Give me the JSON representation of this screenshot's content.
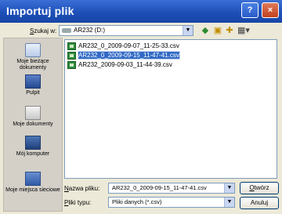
{
  "window": {
    "title": "Importuj plik",
    "help_button": "?",
    "close_button": "×"
  },
  "toolbar": {
    "lookin_label_prefix": "S",
    "lookin_label_rest": "zukaj w:",
    "lookin_value": "AR232 (D:)",
    "back_icon": "back-arrow-icon",
    "up_icon": "folder-up-icon",
    "new_folder_icon": "new-folder-icon",
    "view_icon": "view-menu-icon"
  },
  "places": [
    {
      "label": "Moje bieżące dokumenty"
    },
    {
      "label": "Pulpit"
    },
    {
      "label": "Moje dokumenty"
    },
    {
      "label": "Mój komputer"
    },
    {
      "label": "Moje miejsca sieciowe"
    }
  ],
  "files": [
    {
      "name": "AR232_0_2009-09-07_11-25-33.csv",
      "selected": false
    },
    {
      "name": "AR232_0_2009-09-15_11-47-41.csv",
      "selected": true
    },
    {
      "name": "AR232_2009-09-03_11-44-39.csv",
      "selected": false
    }
  ],
  "filename": {
    "label_prefix": "N",
    "label_rest": "azwa pliku:",
    "value": "AR232_0_2009-09-15_11-47-41.csv"
  },
  "filetype": {
    "label_prefix": "P",
    "label_rest": "liki typu:",
    "value": "Pliki danych (*.csv)"
  },
  "buttons": {
    "open_prefix": "O",
    "open_rest": "twórz",
    "cancel": "Anuluj"
  },
  "colors": {
    "titlebar": "#1d4fb8",
    "selection": "#316ac5",
    "dialog_bg": "#ece9d8"
  }
}
